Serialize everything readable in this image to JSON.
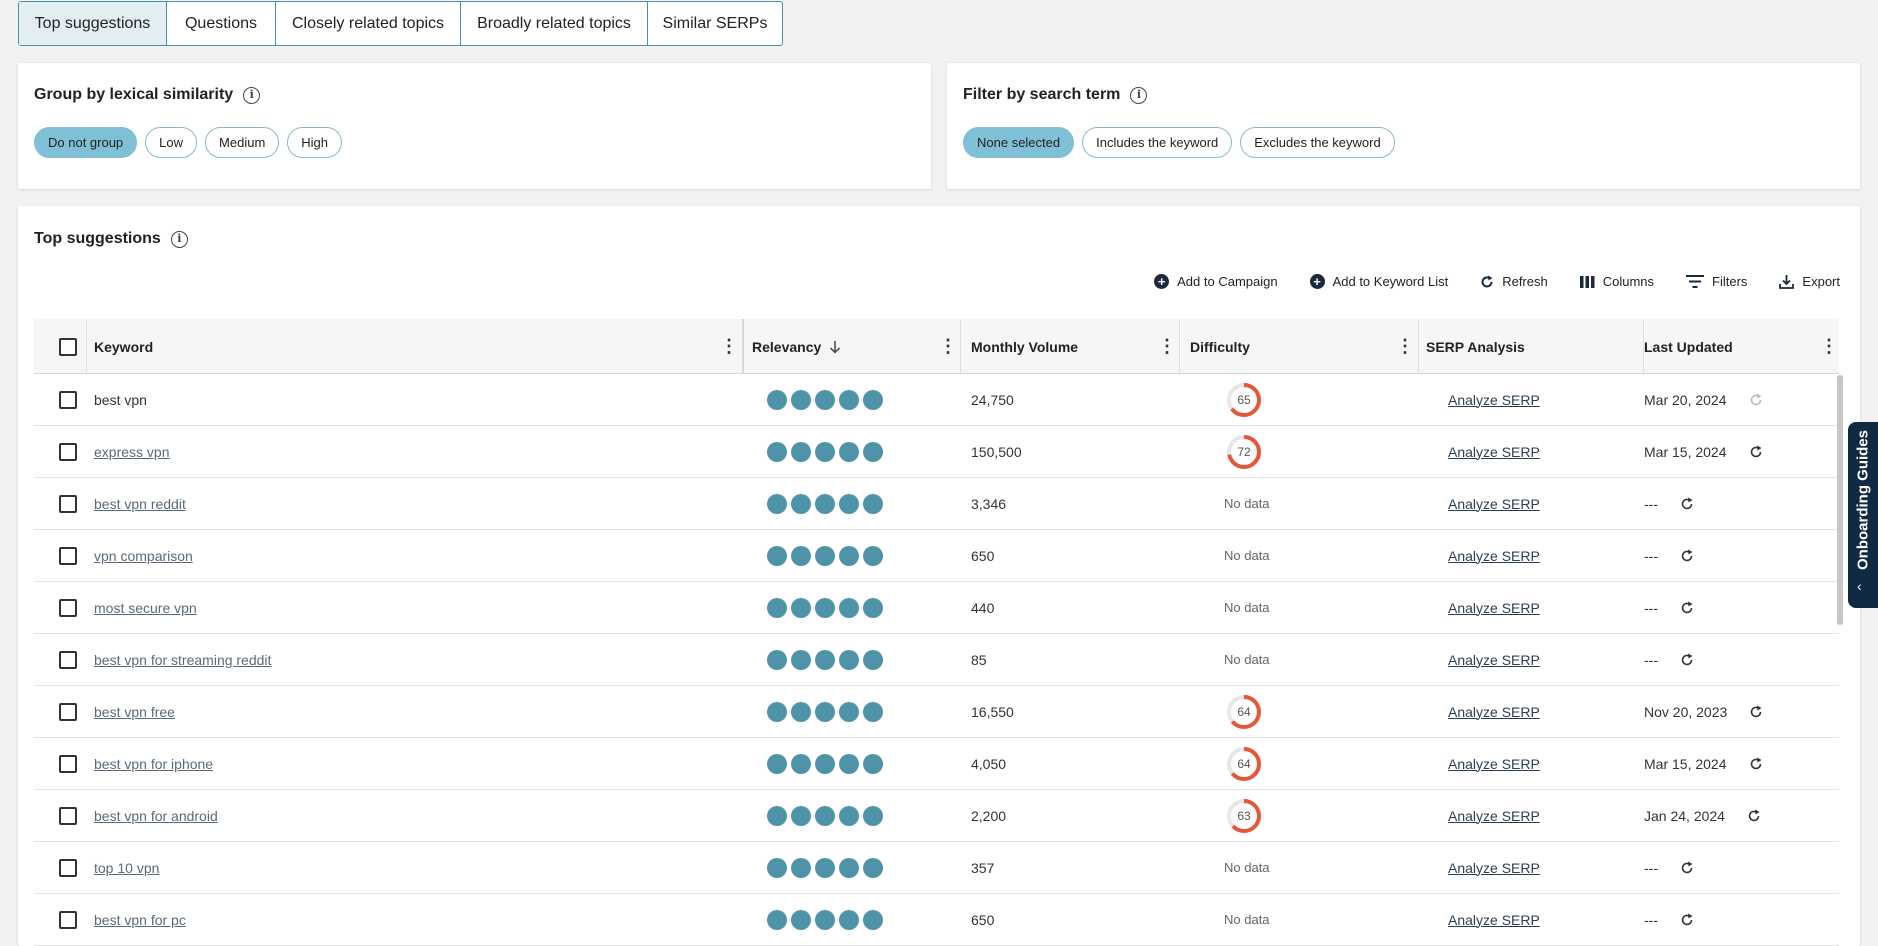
{
  "tabs": [
    {
      "label": "Top suggestions",
      "active": true
    },
    {
      "label": "Questions",
      "active": false
    },
    {
      "label": "Closely related topics",
      "active": false
    },
    {
      "label": "Broadly related topics",
      "active": false
    },
    {
      "label": "Similar SERPs",
      "active": false
    }
  ],
  "group_card": {
    "title": "Group by lexical similarity",
    "options": [
      "Do not group",
      "Low",
      "Medium",
      "High"
    ],
    "selected": "Do not group"
  },
  "filter_card": {
    "title": "Filter by search term",
    "options": [
      "None selected",
      "Includes the keyword",
      "Excludes the keyword"
    ],
    "selected": "None selected"
  },
  "suggestions": {
    "title": "Top suggestions",
    "toolbar": {
      "add_campaign": "Add to Campaign",
      "add_keyword_list": "Add to Keyword List",
      "refresh": "Refresh",
      "columns": "Columns",
      "filters": "Filters",
      "export": "Export"
    },
    "columns": {
      "keyword": "Keyword",
      "relevancy": "Relevancy",
      "monthly_volume": "Monthly Volume",
      "difficulty": "Difficulty",
      "serp_analysis": "SERP Analysis",
      "last_updated": "Last Updated"
    },
    "rows": [
      {
        "keyword": "best vpn",
        "linked": false,
        "relevancy": 5,
        "volume": "24,750",
        "difficulty": 65,
        "serp": "Analyze SERP",
        "updated": "Mar 20, 2024",
        "refresh_dim": true
      },
      {
        "keyword": "express vpn",
        "linked": true,
        "relevancy": 5,
        "volume": "150,500",
        "difficulty": 72,
        "serp": "Analyze SERP",
        "updated": "Mar 15, 2024",
        "refresh_dim": false
      },
      {
        "keyword": "best vpn reddit",
        "linked": true,
        "relevancy": 5,
        "volume": "3,346",
        "difficulty": null,
        "serp": "Analyze SERP",
        "updated": "---",
        "refresh_dim": false
      },
      {
        "keyword": "vpn comparison",
        "linked": true,
        "relevancy": 5,
        "volume": "650",
        "difficulty": null,
        "serp": "Analyze SERP",
        "updated": "---",
        "refresh_dim": false
      },
      {
        "keyword": "most secure vpn",
        "linked": true,
        "relevancy": 5,
        "volume": "440",
        "difficulty": null,
        "serp": "Analyze SERP",
        "updated": "---",
        "refresh_dim": false
      },
      {
        "keyword": "best vpn for streaming reddit",
        "linked": true,
        "relevancy": 5,
        "volume": "85",
        "difficulty": null,
        "serp": "Analyze SERP",
        "updated": "---",
        "refresh_dim": false
      },
      {
        "keyword": "best vpn free",
        "linked": true,
        "relevancy": 5,
        "volume": "16,550",
        "difficulty": 64,
        "serp": "Analyze SERP",
        "updated": "Nov 20, 2023",
        "refresh_dim": false
      },
      {
        "keyword": "best vpn for iphone",
        "linked": true,
        "relevancy": 5,
        "volume": "4,050",
        "difficulty": 64,
        "serp": "Analyze SERP",
        "updated": "Mar 15, 2024",
        "refresh_dim": false
      },
      {
        "keyword": "best vpn for android",
        "linked": true,
        "relevancy": 5,
        "volume": "2,200",
        "difficulty": 63,
        "serp": "Analyze SERP",
        "updated": "Jan 24, 2024",
        "refresh_dim": false
      },
      {
        "keyword": "top 10 vpn",
        "linked": true,
        "relevancy": 5,
        "volume": "357",
        "difficulty": null,
        "serp": "Analyze SERP",
        "updated": "---",
        "refresh_dim": false
      },
      {
        "keyword": "best vpn for pc",
        "linked": true,
        "relevancy": 5,
        "volume": "650",
        "difficulty": null,
        "serp": "Analyze SERP",
        "updated": "---",
        "refresh_dim": false
      }
    ],
    "no_data_label": "No data"
  },
  "onboarding": {
    "label": "Onboarding Guides"
  },
  "colors": {
    "accent": "#4f93a9",
    "chip_active": "#7fc0d6",
    "difficulty_ring": "#e4573a",
    "guide_bg": "#102a43"
  }
}
